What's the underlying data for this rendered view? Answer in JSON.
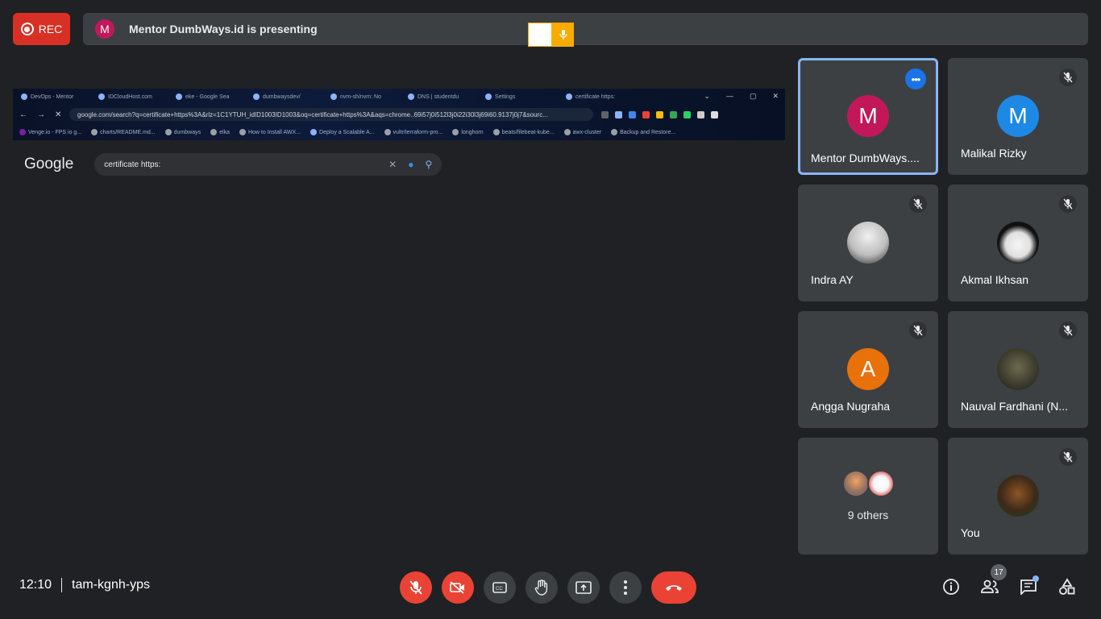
{
  "recording": {
    "label": "REC"
  },
  "banner": {
    "avatar_letter": "M",
    "text": "Mentor DumbWays.id is presenting"
  },
  "shared_screen": {
    "tabs": [
      "DevOps - Mentor",
      "IDCloudHost.com",
      "eke - Google Sea",
      "dumbwaysdev/",
      "nvm-sh/nvm: No",
      "DNS | studentdu",
      "Settings",
      "certificate https:"
    ],
    "url": "google.com/search?q=certificate+https%3A&rlz=1C1YTUH_idID1003ID1003&oq=certificate+https%3A&aqs=chrome..69i57j0i512l3j0i22i30l3j69i60.9137j0j7&sourc...",
    "bookmarks": [
      "Venge.io - FPS io g...",
      "charts/README.md...",
      "dumbways",
      "elka",
      "How to Install AWX...",
      "Deploy a Scalable A...",
      "vultr/terraform-pro...",
      "longhorn",
      "beats/filebeat-kube...",
      "awx-cluster",
      "Backup and Restore..."
    ],
    "google_logo": "Google",
    "search_query": "certificate https:"
  },
  "participants": [
    {
      "name": "Mentor DumbWays....",
      "letter": "M",
      "color": "#c2185b",
      "active": true,
      "muted": false
    },
    {
      "name": "Malikal Rizky",
      "letter": "M",
      "color": "#1e88e5",
      "active": false,
      "muted": true
    },
    {
      "name": "Indra AY",
      "letter": "",
      "color": "#e0e0e0",
      "active": false,
      "muted": true
    },
    {
      "name": "Akmal Ikhsan",
      "letter": "",
      "color": "#111111",
      "active": false,
      "muted": true
    },
    {
      "name": "Angga Nugraha",
      "letter": "A",
      "color": "#e8710a",
      "active": false,
      "muted": true
    },
    {
      "name": "Nauval Fardhani (N...",
      "letter": "",
      "color": "#4a4a3a",
      "active": false,
      "muted": true
    },
    {
      "name": "You",
      "letter": "",
      "color": "#3a2e22",
      "active": false,
      "muted": true
    }
  ],
  "others": {
    "label": "9 others"
  },
  "meeting": {
    "time": "12:10",
    "code": "tam-kgnh-yps"
  },
  "people_count": "17"
}
